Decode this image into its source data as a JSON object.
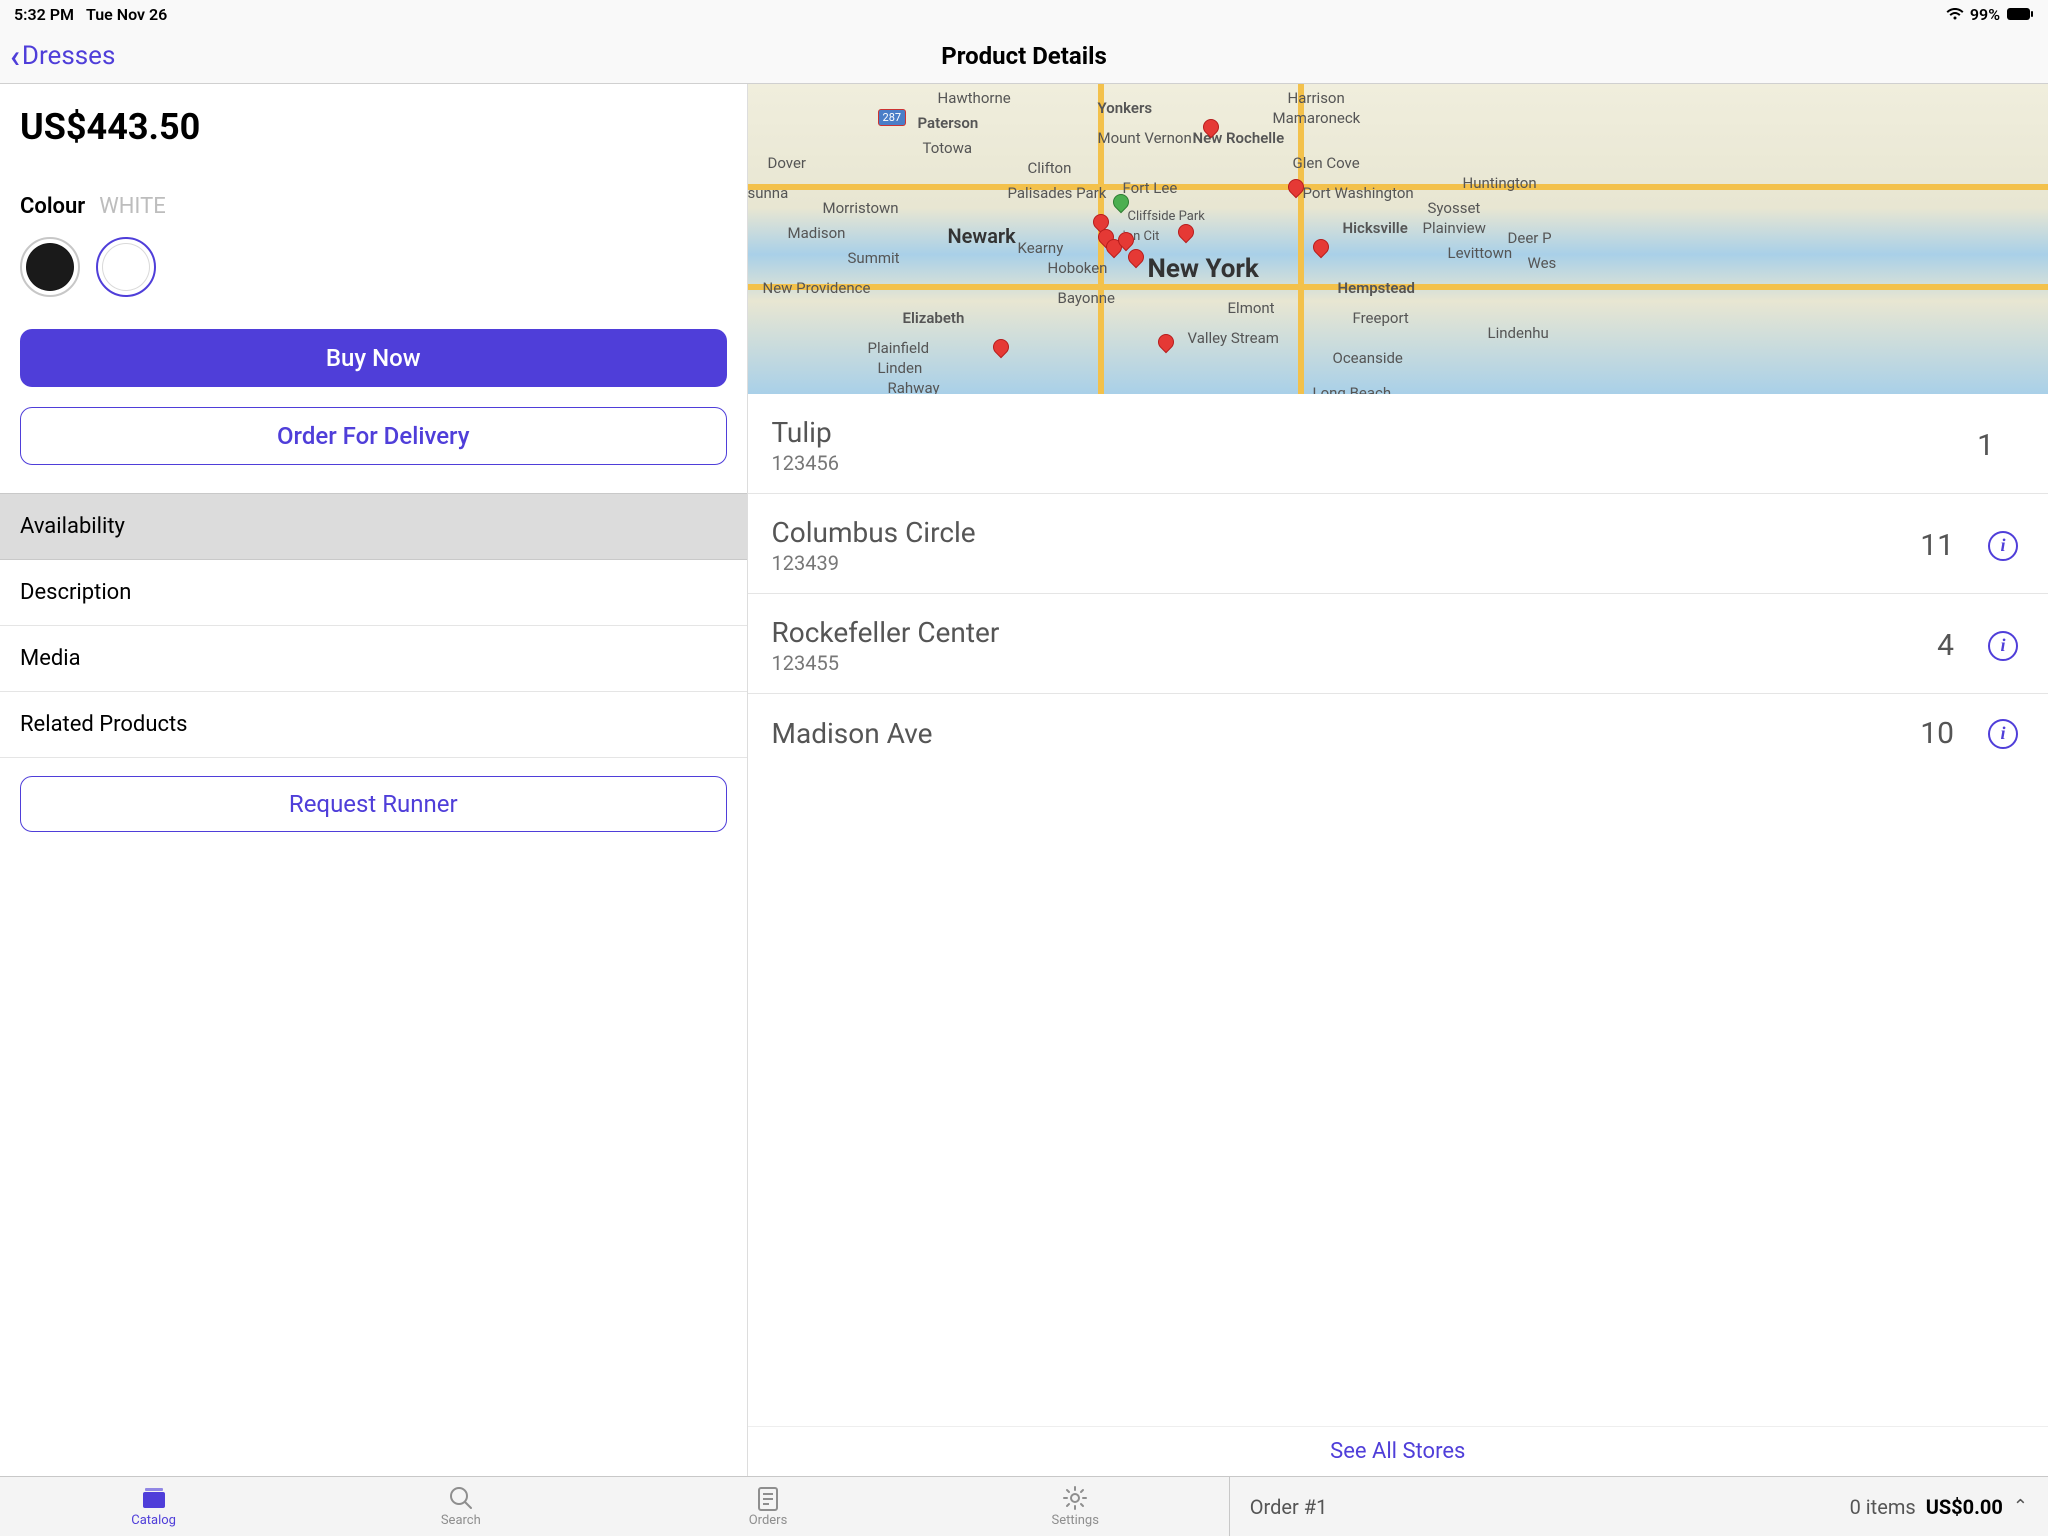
{
  "status": {
    "time": "5:32 PM",
    "date": "Tue Nov 26",
    "battery": "99%"
  },
  "nav": {
    "back_label": "Dresses",
    "title": "Product Details"
  },
  "product": {
    "price": "US$443.50",
    "colour_label": "Colour",
    "colour_value": "WHITE",
    "buy_label": "Buy Now",
    "order_delivery_label": "Order For Delivery",
    "request_runner_label": "Request Runner"
  },
  "sections": {
    "availability": "Availability",
    "description": "Description",
    "media": "Media",
    "related": "Related Products"
  },
  "map_labels": {
    "newyork": "New York",
    "newark": "Newark",
    "yonkers": "Yonkers",
    "paterson": "Paterson",
    "clifton": "Clifton",
    "hoboken": "Hoboken",
    "bayonne": "Bayonne",
    "elizabeth": "Elizabeth",
    "linden": "Linden",
    "rahway": "Rahway",
    "morristown": "Morristown",
    "madison": "Madison",
    "summit": "Summit",
    "dover": "Dover",
    "hawthorne": "Hawthorne",
    "totowa": "Totowa",
    "palisades": "Palisades Park",
    "fortlee": "Fort Lee",
    "cliffside": "Cliffside Park",
    "kearny": "Kearny",
    "mtvernon": "Mount Vernon",
    "newrochelle": "New Rochelle",
    "harrison": "Harrison",
    "mamaroneck": "Mamaroneck",
    "glencove": "Glen Cove",
    "portwash": "Port Washington",
    "hicksville": "Hicksville",
    "levittown": "Levittown",
    "hempstead": "Hempstead",
    "freeport": "Freeport",
    "elmont": "Elmont",
    "valleystream": "Valley Stream",
    "oceanside": "Oceanside",
    "longbeach": "Long Beach",
    "syosset": "Syosset",
    "plainview": "Plainview",
    "huntington": "Huntington",
    "lindenhu": "Lindenhu",
    "deerp": "Deer P",
    "wes": "Wes",
    "newprov": "New Providence",
    "sunna": "sunna",
    "plainfield": "Plainfield",
    "i287": "287",
    "ioncit": "ion Cit"
  },
  "stores": [
    {
      "name": "Tulip",
      "code": "123456",
      "qty": "1",
      "info": false
    },
    {
      "name": "Columbus Circle",
      "code": "123439",
      "qty": "11",
      "info": true
    },
    {
      "name": "Rockefeller Center",
      "code": "123455",
      "qty": "4",
      "info": true
    },
    {
      "name": "Madison Ave",
      "code": "",
      "qty": "10",
      "info": true
    }
  ],
  "see_all": "See All Stores",
  "tabs": {
    "catalog": "Catalog",
    "search": "Search",
    "orders": "Orders",
    "settings": "Settings"
  },
  "order_bar": {
    "label": "Order #1",
    "items": "0 items",
    "total": "US$0.00"
  }
}
